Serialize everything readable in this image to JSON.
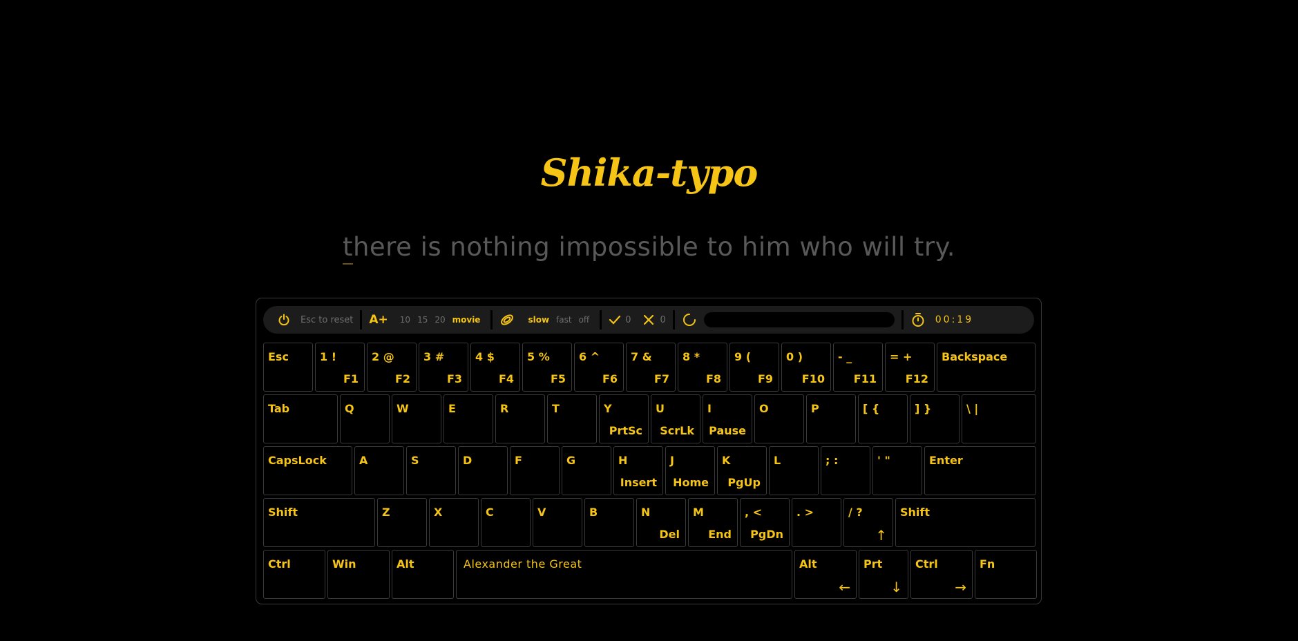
{
  "app": {
    "title": "Shika-typo",
    "quote_first_char": "t",
    "quote_rest": "here is nothing impossible to him who will try."
  },
  "toolbar": {
    "reset_label": "Esc to reset",
    "font_options": [
      "10",
      "15",
      "20",
      "movie"
    ],
    "font_selected": "movie",
    "speed_options": [
      "slow",
      "fast",
      "off"
    ],
    "speed_selected": "slow",
    "correct_count": "0",
    "wrong_count": "0",
    "progress": 0,
    "timer": "00:19",
    "accent_color": "#f5c414"
  },
  "keyboard": {
    "rows": [
      [
        {
          "name": "key-esc",
          "tl": "Esc",
          "br": ""
        },
        {
          "name": "key-1",
          "tl": "1 !",
          "br": "F1"
        },
        {
          "name": "key-2",
          "tl": "2 @",
          "br": "F2"
        },
        {
          "name": "key-3",
          "tl": "3 #",
          "br": "F3"
        },
        {
          "name": "key-4",
          "tl": "4 $",
          "br": "F4"
        },
        {
          "name": "key-5",
          "tl": "5 %",
          "br": "F5"
        },
        {
          "name": "key-6",
          "tl": "6 ^",
          "br": "F6"
        },
        {
          "name": "key-7",
          "tl": "7 &",
          "br": "F7"
        },
        {
          "name": "key-8",
          "tl": "8 *",
          "br": "F8"
        },
        {
          "name": "key-9",
          "tl": "9 (",
          "br": "F9"
        },
        {
          "name": "key-0",
          "tl": "0 )",
          "br": "F10"
        },
        {
          "name": "key-minus",
          "tl": "- _",
          "br": "F11"
        },
        {
          "name": "key-equals",
          "tl": "= +",
          "br": "F12"
        },
        {
          "name": "key-backspace",
          "tl": "Backspace",
          "br": ""
        }
      ],
      [
        {
          "name": "key-tab",
          "tl": "Tab",
          "br": ""
        },
        {
          "name": "key-q",
          "tl": "Q",
          "br": ""
        },
        {
          "name": "key-w",
          "tl": "W",
          "br": ""
        },
        {
          "name": "key-e",
          "tl": "E",
          "br": ""
        },
        {
          "name": "key-r",
          "tl": "R",
          "br": ""
        },
        {
          "name": "key-t",
          "tl": "T",
          "br": ""
        },
        {
          "name": "key-y",
          "tl": "Y",
          "br": "PrtSc"
        },
        {
          "name": "key-u",
          "tl": "U",
          "br": "ScrLk"
        },
        {
          "name": "key-i",
          "tl": "I",
          "br": "Pause"
        },
        {
          "name": "key-o",
          "tl": "O",
          "br": ""
        },
        {
          "name": "key-p",
          "tl": "P",
          "br": ""
        },
        {
          "name": "key-lbracket",
          "tl": "[ {",
          "br": ""
        },
        {
          "name": "key-rbracket",
          "tl": "] }",
          "br": ""
        },
        {
          "name": "key-backslash",
          "tl": "\\ |",
          "br": ""
        }
      ],
      [
        {
          "name": "key-capslock",
          "tl": "CapsLock",
          "br": ""
        },
        {
          "name": "key-a",
          "tl": "A",
          "br": ""
        },
        {
          "name": "key-s",
          "tl": "S",
          "br": ""
        },
        {
          "name": "key-d",
          "tl": "D",
          "br": ""
        },
        {
          "name": "key-f",
          "tl": "F",
          "br": ""
        },
        {
          "name": "key-g",
          "tl": "G",
          "br": ""
        },
        {
          "name": "key-h",
          "tl": "H",
          "br": "Insert"
        },
        {
          "name": "key-j",
          "tl": "J",
          "br": "Home"
        },
        {
          "name": "key-k",
          "tl": "K",
          "br": "PgUp"
        },
        {
          "name": "key-l",
          "tl": "L",
          "br": ""
        },
        {
          "name": "key-semicolon",
          "tl": "; :",
          "br": ""
        },
        {
          "name": "key-quote",
          "tl": "' \"",
          "br": ""
        },
        {
          "name": "key-enter",
          "tl": "Enter",
          "br": ""
        }
      ],
      [
        {
          "name": "key-shift-left",
          "tl": "Shift",
          "br": ""
        },
        {
          "name": "key-z",
          "tl": "Z",
          "br": ""
        },
        {
          "name": "key-x",
          "tl": "X",
          "br": ""
        },
        {
          "name": "key-c",
          "tl": "C",
          "br": ""
        },
        {
          "name": "key-v",
          "tl": "V",
          "br": ""
        },
        {
          "name": "key-b",
          "tl": "B",
          "br": ""
        },
        {
          "name": "key-n",
          "tl": "N",
          "br": "Del"
        },
        {
          "name": "key-m",
          "tl": "M",
          "br": "End"
        },
        {
          "name": "key-comma",
          "tl": ", <",
          "br": "PgDn"
        },
        {
          "name": "key-period",
          "tl": ". >",
          "br": ""
        },
        {
          "name": "key-slash",
          "tl": "/ ?",
          "br": "↑"
        },
        {
          "name": "key-shift-right",
          "tl": "Shift",
          "br": ""
        }
      ],
      [
        {
          "name": "key-ctrl-left",
          "tl": "Ctrl",
          "br": ""
        },
        {
          "name": "key-win",
          "tl": "Win",
          "br": ""
        },
        {
          "name": "key-alt-left",
          "tl": "Alt",
          "br": ""
        },
        {
          "name": "key-space",
          "tl": "Alexander the Great",
          "br": ""
        },
        {
          "name": "key-alt-right",
          "tl": "Alt",
          "br": "←"
        },
        {
          "name": "key-prt",
          "tl": "Prt",
          "br": "↓"
        },
        {
          "name": "key-ctrl-right",
          "tl": "Ctrl",
          "br": "→"
        },
        {
          "name": "key-fn",
          "tl": "Fn",
          "br": ""
        }
      ]
    ]
  }
}
